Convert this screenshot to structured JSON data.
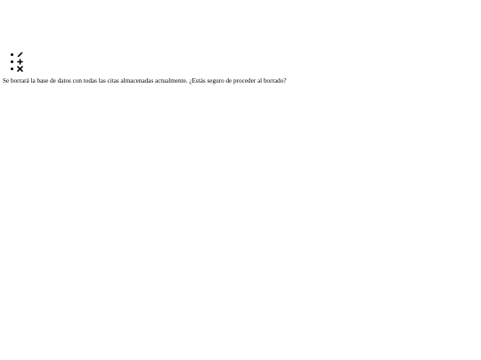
{
  "toolbar": {
    "items": [
      {
        "icon": "pencil-icon",
        "action": "edit"
      },
      {
        "icon": "plus-icon",
        "action": "add"
      },
      {
        "icon": "close-icon",
        "action": "delete"
      }
    ]
  },
  "dialog": {
    "message": "Se borrará la base de datos con todas las citas almacenadas actualmente. ¿Estás seguro de proceder al borrado?"
  }
}
